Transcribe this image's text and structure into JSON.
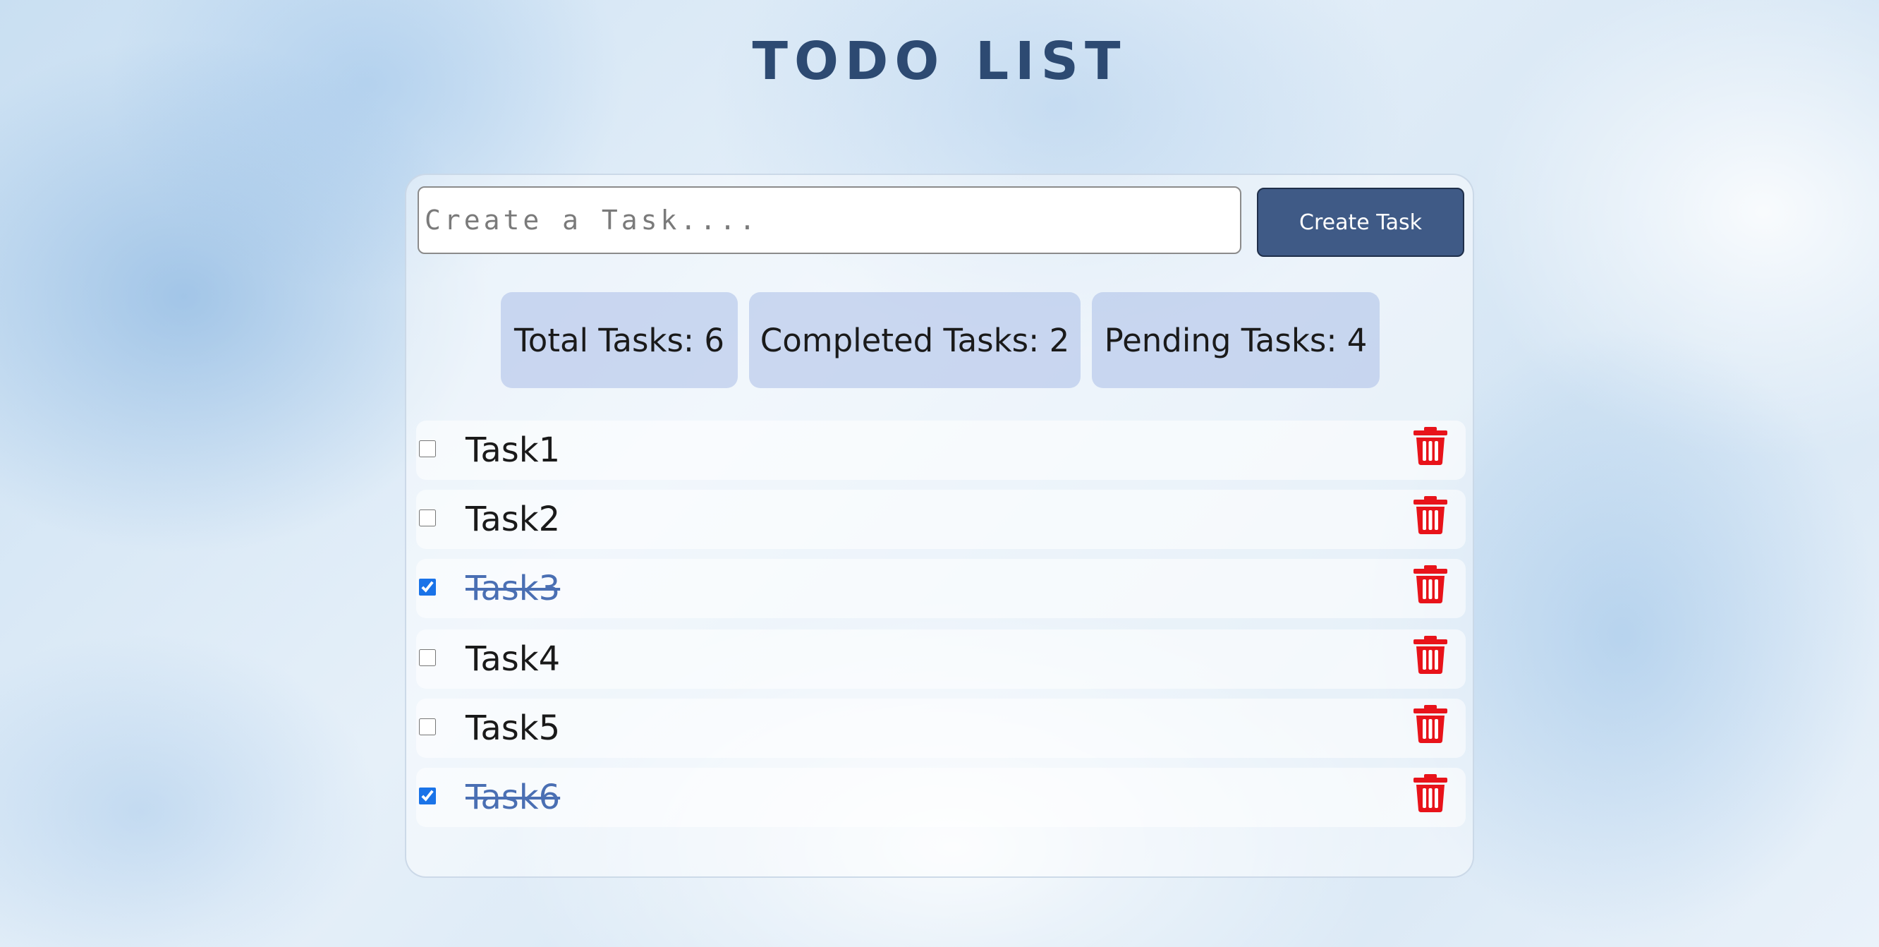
{
  "page": {
    "title": "TODO LIST"
  },
  "form": {
    "input_value": "",
    "input_placeholder": "Create a Task....",
    "create_button_label": "Create Task"
  },
  "stats": {
    "total": "Total Tasks: 6",
    "completed": "Completed Tasks: 2",
    "pending": "Pending Tasks: 4"
  },
  "tasks": [
    {
      "label": "Task1",
      "completed": false
    },
    {
      "label": "Task2",
      "completed": false
    },
    {
      "label": "Task3",
      "completed": true
    },
    {
      "label": "Task4",
      "completed": false
    },
    {
      "label": "Task5",
      "completed": false
    },
    {
      "label": "Task6",
      "completed": true
    }
  ],
  "colors": {
    "title": "#2d4a72",
    "button_bg": "#3f5a86",
    "stat_bg": "#b2c4e8",
    "completed_text": "#4a6fb3",
    "delete_icon": "#e8131a",
    "checkbox_accent": "#1a73e8"
  },
  "icons": {
    "delete": "trash-icon"
  }
}
